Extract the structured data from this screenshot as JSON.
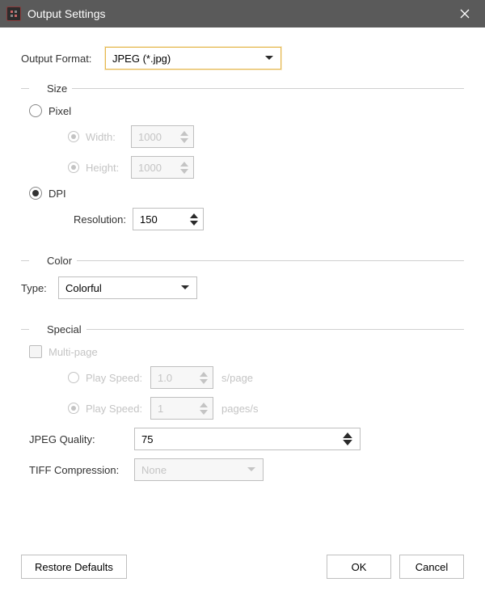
{
  "titlebar": {
    "title": "Output Settings"
  },
  "outputFormat": {
    "label": "Output Format:",
    "value": "JPEG (*.jpg)"
  },
  "size": {
    "legend": "Size",
    "pixel": {
      "label": "Pixel",
      "width_label": "Width:",
      "width_value": "1000",
      "height_label": "Height:",
      "height_value": "1000"
    },
    "dpi": {
      "label": "DPI",
      "resolution_label": "Resolution:",
      "resolution_value": "150"
    }
  },
  "color": {
    "legend": "Color",
    "type_label": "Type:",
    "type_value": "Colorful"
  },
  "special": {
    "legend": "Special",
    "multipage_label": "Multi-page",
    "playspeed1_label": "Play Speed:",
    "playspeed1_value": "1.0",
    "playspeed1_unit": "s/page",
    "playspeed2_label": "Play Speed:",
    "playspeed2_value": "1",
    "playspeed2_unit": "pages/s",
    "jpeg_label": "JPEG Quality:",
    "jpeg_value": "75",
    "tiff_label": "TIFF Compression:",
    "tiff_value": "None"
  },
  "buttons": {
    "restore": "Restore Defaults",
    "ok": "OK",
    "cancel": "Cancel"
  }
}
